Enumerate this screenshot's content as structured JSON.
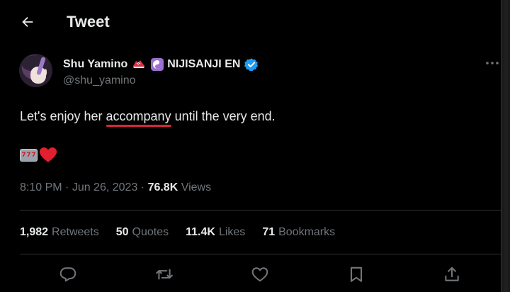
{
  "header": {
    "title": "Tweet"
  },
  "author": {
    "display_name": "Shu Yamino",
    "org": "NIJISANJI EN",
    "handle": "@shu_yamino"
  },
  "tweet": {
    "text_before": "Let's enjoy her ",
    "text_typo": "accompany",
    "text_after": " until the very end.",
    "slot_digits": [
      "7",
      "7",
      "7"
    ],
    "time": "8:10 PM",
    "sep1": " · ",
    "date": "Jun 26, 2023",
    "sep2": " · ",
    "views_count": "76.8K",
    "views_label": " Views"
  },
  "stats": {
    "retweets": {
      "count": "1,982",
      "label": "Retweets"
    },
    "quotes": {
      "count": "50",
      "label": "Quotes"
    },
    "likes": {
      "count": "11.4K",
      "label": "Likes"
    },
    "bookmarks": {
      "count": "71",
      "label": "Bookmarks"
    }
  },
  "icons": {
    "back": "arrow-left-icon",
    "more": "more-horizontal-icon",
    "verified": "verified-badge-icon",
    "shoe_emoji": "running-shoe-icon",
    "yin_yang_emoji": "yin-yang-icon",
    "slot_emoji": "slot-machine-icon",
    "heart_emoji": "red-heart-icon",
    "reply": "reply-icon",
    "retweet": "retweet-icon",
    "like": "like-icon",
    "bookmark": "bookmark-icon",
    "share": "share-icon"
  },
  "colors": {
    "background": "#000000",
    "text": "#e7e9ea",
    "muted": "#71767b",
    "verified_blue": "#1d9bf0",
    "spellcheck_red": "#d6263a",
    "yin_yang_purple": "#9b6fd1"
  }
}
